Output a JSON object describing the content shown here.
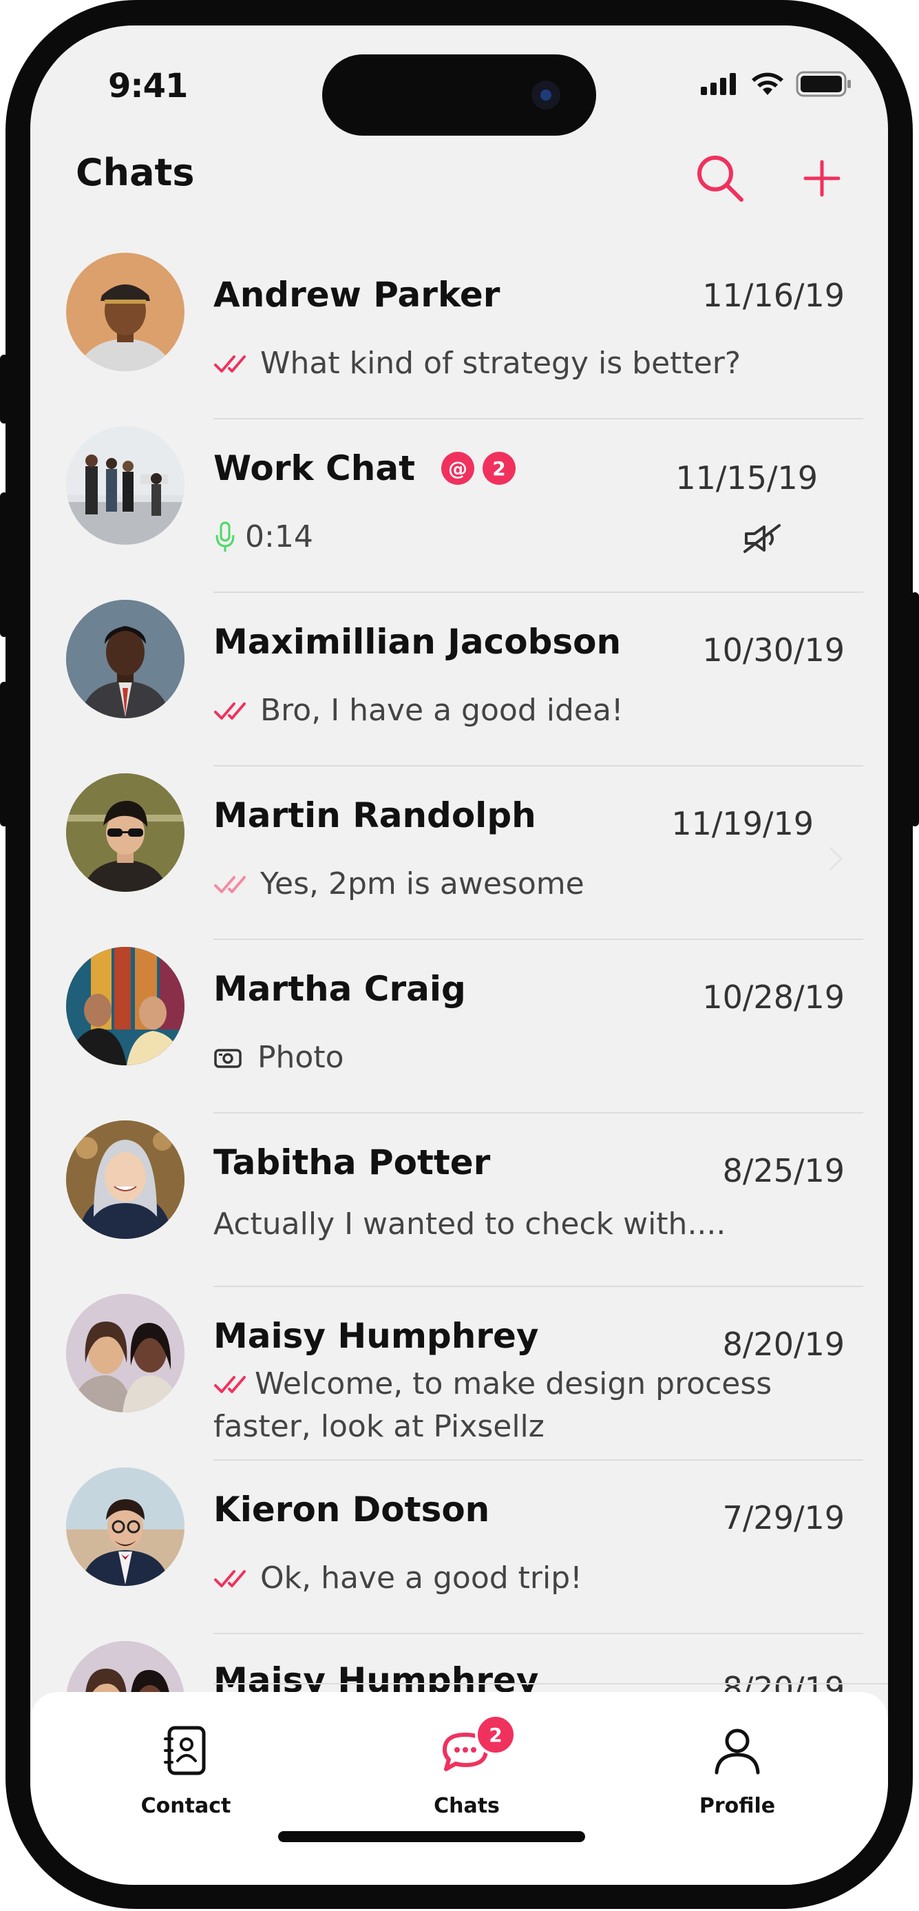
{
  "status_bar": {
    "time": "9:41"
  },
  "header": {
    "title": "Chats",
    "search_icon": "search-icon",
    "add_icon": "plus-icon"
  },
  "colors": {
    "accent": "#f0315e",
    "voice": "#4cd964",
    "background": "#f1f1f1"
  },
  "chats": [
    {
      "name": "Andrew Parker",
      "date": "11/16/19",
      "message": "What kind of strategy is better?",
      "status": "read-double-check"
    },
    {
      "name": "Work Chat",
      "date": "11/15/19",
      "message": "0:14",
      "mention_badge": "@",
      "unread_badge": "2",
      "attachment": "microphone-icon",
      "muted": true
    },
    {
      "name": "Maximillian Jacobson",
      "date": "10/30/19",
      "message": "Bro, I have a good idea!",
      "status": "read-double-check"
    },
    {
      "name": "Martin Randolph",
      "date": "11/19/19",
      "message": "Yes, 2pm is awesome",
      "status": "delivered-double-check"
    },
    {
      "name": "Martha Craig",
      "date": "10/28/19",
      "message": "Photo",
      "attachment": "camera-icon"
    },
    {
      "name": "Tabitha Potter",
      "date": "8/25/19",
      "message": "Actually I wanted to check with...."
    },
    {
      "name": "Maisy Humphrey",
      "date": "8/20/19",
      "message": "Welcome, to make design process faster, look at Pixsellz",
      "status": "read-double-check"
    },
    {
      "name": "Kieron Dotson",
      "date": "7/29/19",
      "message": "Ok, have a good trip!",
      "status": "read-double-check"
    },
    {
      "name": "Maisy Humphrey",
      "date": "8/20/19"
    }
  ],
  "tabbar": {
    "items": [
      {
        "label": "Contact",
        "icon": "contacts-book-icon"
      },
      {
        "label": "Chats",
        "icon": "chat-bubble-icon",
        "badge": "2"
      },
      {
        "label": "Profile",
        "icon": "person-icon"
      }
    ]
  }
}
